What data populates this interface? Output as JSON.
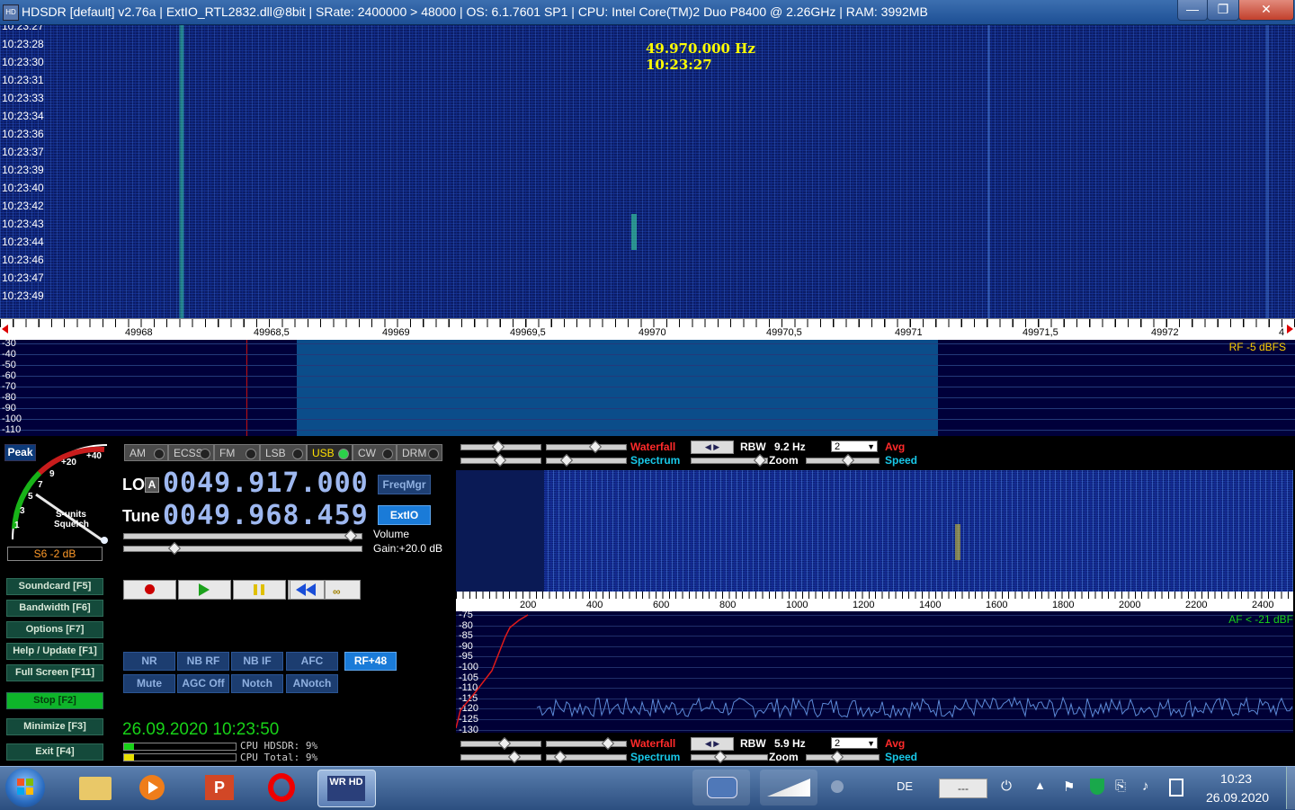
{
  "titlebar": {
    "title": "HDSDR  [default]  v2.76a  |  ExtIO_RTL2832.dll@8bit  |  SRate: 2400000 > 48000  |  OS: 6.1.7601 SP1  |  CPU: Intel Core(TM)2 Duo      P8400  @ 2.26GHz  |  RAM: 3992MB",
    "minimize": "—",
    "maximize": "❐",
    "close": "✕"
  },
  "waterfall": {
    "freq_readout": "49.970.000 Hz",
    "time_readout": "10:23:27",
    "timestamps": [
      "10:23:27",
      "10:23:28",
      "10:23:30",
      "10:23:31",
      "10:23:33",
      "10:23:34",
      "10:23:36",
      "10:23:37",
      "10:23:39",
      "10:23:40",
      "10:23:42",
      "10:23:43",
      "10:23:44",
      "10:23:46",
      "10:23:47",
      "10:23:49"
    ]
  },
  "freq_scale": {
    "labels": [
      "49968",
      "49968,5",
      "49969",
      "49969,5",
      "49970",
      "49970,5",
      "49971",
      "49971,5",
      "49972"
    ],
    "right_arrow": "4"
  },
  "spectrum": {
    "db_labels": [
      "-30",
      "-40",
      "-50",
      "-60",
      "-70",
      "-80",
      "-90",
      "-100",
      "-110"
    ],
    "rf_label": "RF  -5 dBFS"
  },
  "smeter": {
    "peak_label": "Peak",
    "scale": [
      "+40",
      "+20",
      "9",
      "7",
      "5",
      "3",
      "1"
    ],
    "sunits": "S-units",
    "squelch": "Squelch",
    "reading": "S6 -2 dB"
  },
  "modes": [
    {
      "label": "AM",
      "selected": false
    },
    {
      "label": "ECSS",
      "selected": false
    },
    {
      "label": "FM",
      "selected": false
    },
    {
      "label": "LSB",
      "selected": false
    },
    {
      "label": "USB",
      "selected": true
    },
    {
      "label": "CW",
      "selected": false
    },
    {
      "label": "DRM",
      "selected": false
    }
  ],
  "lo": {
    "label": "LO",
    "sublabel": "A",
    "value": "0049.917.000"
  },
  "tune": {
    "label": "Tune",
    "value": "0049.968.459"
  },
  "freqmgr": "FreqMgr",
  "extio": "ExtIO",
  "volume": {
    "label": "Volume",
    "gain": "Gain:+20.0 dB"
  },
  "sidebuttons": [
    {
      "label": "Soundcard  [F5]",
      "active": false
    },
    {
      "label": "Bandwidth  [F6]",
      "active": false
    },
    {
      "label": "Options    [F7]",
      "active": false
    },
    {
      "label": "Help / Update  [F1]",
      "active": false
    },
    {
      "label": "Full Screen  [F11]",
      "active": false
    },
    {
      "label": "Stop        [F2]",
      "active": true
    },
    {
      "label": "Minimize  [F3]",
      "active": false
    },
    {
      "label": "Exit        [F4]",
      "active": false
    }
  ],
  "dsp": {
    "row1": [
      "NR",
      "NB RF",
      "NB IF",
      "AFC"
    ],
    "row2": [
      "Mute",
      "AGC Off",
      "Notch",
      "ANotch"
    ],
    "rf_offset": "RF+48"
  },
  "status": {
    "datetime": "26.09.2020 10:23:50",
    "cpu_hdsdr": "CPU HDSDR: 9%",
    "cpu_total": "CPU Total: 9%"
  },
  "rf_controls": {
    "waterfall": "Waterfall",
    "spectrum": "Spectrum",
    "rbw_label": "RBW",
    "rbw_value": "9.2 Hz",
    "zoom": "Zoom",
    "avg_value": "2",
    "avg": "Avg",
    "speed": "Speed"
  },
  "af_controls": {
    "waterfall": "Waterfall",
    "spectrum": "Spectrum",
    "rbw_label": "RBW",
    "rbw_value": "5.9 Hz",
    "zoom": "Zoom",
    "avg_value": "2",
    "avg": "Avg",
    "speed": "Speed"
  },
  "af_scale": {
    "labels": [
      "200",
      "400",
      "600",
      "800",
      "1000",
      "1200",
      "1400",
      "1600",
      "1800",
      "2000",
      "2200",
      "2400"
    ]
  },
  "af_spectrum": {
    "db_labels": [
      "-75",
      "-80",
      "-85",
      "-90",
      "-95",
      "-100",
      "-105",
      "-110",
      "-115",
      "-120",
      "-125",
      "-130"
    ],
    "af_label": "AF < -21 dBF"
  },
  "taskbar": {
    "language": "DE",
    "time": "10:23",
    "date": "26.09.2020",
    "box": "---",
    "hdsdr_icon": "WR HD"
  },
  "colors": {
    "accent_green": "#0eb52a",
    "waterfall_blue": "#0b1e6a",
    "readout_yellow": "#ffff00"
  }
}
